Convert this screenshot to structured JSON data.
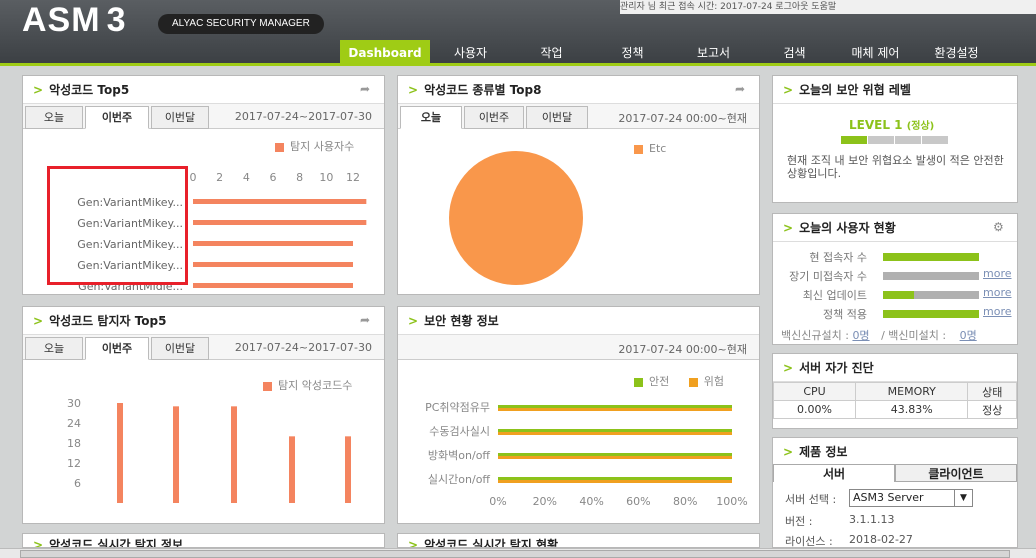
{
  "header": {
    "logo": "ASM",
    "logo_num": "3",
    "tagline": "ALYAC SECURITY MANAGER",
    "top_strip": "관리자 님    최근 접속 시간: 2017-07-24    로그아웃    도움말"
  },
  "nav": {
    "items": [
      "Dashboard",
      "사용자",
      "작업",
      "정책",
      "보고서",
      "검색",
      "매체 제어",
      "환경설정"
    ]
  },
  "malware_top5": {
    "title": "악성코드 Top5",
    "tabs": [
      "오늘",
      "이번주",
      "이번달"
    ],
    "active_tab": "이번주",
    "date_range": "2017-07-24~2017-07-30",
    "legend": "탐지 사용자수",
    "legend_color": "#f4845f",
    "chart_data": {
      "type": "bar",
      "orientation": "horizontal",
      "categories": [
        "Gen:VariantMikey...",
        "Gen:VariantMikey...",
        "Gen:VariantMikey...",
        "Gen:VariantMikey...",
        "Gen:VariantMidie..."
      ],
      "series": [
        {
          "name": "탐지 사용자수",
          "values": [
            13,
            13,
            12,
            12,
            12
          ]
        }
      ],
      "xticks": [
        "0",
        "2",
        "4",
        "6",
        "8",
        "10",
        "12"
      ],
      "xlim": [
        0,
        12
      ]
    }
  },
  "malware_type_top8": {
    "title": "악성코드 종류별 Top8",
    "tabs": [
      "오늘",
      "이번주",
      "이번달"
    ],
    "active_tab": "오늘",
    "date_range": "2017-07-24 00:00~현재",
    "legend": "Etc",
    "legend_color": "#f9974b",
    "chart_data": {
      "type": "pie",
      "categories": [
        "Etc"
      ],
      "values": [
        100
      ]
    }
  },
  "detector_top5": {
    "title": "악성코드 탐지자 Top5",
    "tabs": [
      "오늘",
      "이번주",
      "이번달"
    ],
    "active_tab": "이번주",
    "date_range": "2017-07-24~2017-07-30",
    "legend": "탐지 악성코드수",
    "legend_color": "#f4845f",
    "chart_data": {
      "type": "bar",
      "categories": [
        "",
        "",
        "",
        "",
        ""
      ],
      "series": [
        {
          "name": "탐지 악성코드수",
          "values": [
            30,
            29,
            29,
            20,
            20
          ]
        }
      ],
      "yticks": [
        "6",
        "12",
        "18",
        "24",
        "30"
      ],
      "ylim": [
        0,
        33
      ]
    }
  },
  "security_status": {
    "title": "보안 현황 정보",
    "date_range": "2017-07-24 00:00~현재",
    "legend_safe": "안전",
    "legend_risk": "위험",
    "color_safe": "#8cc21a",
    "color_risk": "#f0a020",
    "chart_data": {
      "type": "bar",
      "orientation": "horizontal",
      "categories": [
        "PC취약점유무",
        "수동검사실시",
        "방화벽on/off",
        "실시간on/off"
      ],
      "series": [
        {
          "name": "안전",
          "values": [
            100,
            100,
            100,
            100
          ]
        },
        {
          "name": "위험",
          "values": [
            0,
            0,
            0,
            0
          ]
        }
      ],
      "xticks": [
        "0%",
        "20%",
        "40%",
        "60%",
        "80%",
        "100%"
      ],
      "xlim": [
        0,
        100
      ]
    }
  },
  "threat_level": {
    "title": "오늘의 보안 위협 레벨",
    "level": "LEVEL 1",
    "level_tag": "(정상)",
    "level_value": 1,
    "level_max": 4,
    "description": "현재 조직 내 보안 위협요소 발생이 적은 안전한 상황입니다."
  },
  "user_status": {
    "title": "오늘의 사용자 현황",
    "rows": [
      {
        "label": "현 접속자 수",
        "fill": 1.0,
        "more": ""
      },
      {
        "label": "장기 미접속자 수",
        "fill": 0.0,
        "more": "more"
      },
      {
        "label": "최신 업데이트",
        "fill": 0.32,
        "more": "more"
      },
      {
        "label": "정책 적용",
        "fill": 1.0,
        "more": "more"
      }
    ],
    "vaccine_new_label": "백신신규설치 :",
    "vaccine_new_val": "0명",
    "vaccine_not_label": "/ 백신미설치 :",
    "vaccine_not_val": "0명"
  },
  "server_diag": {
    "title": "서버 자가 진단",
    "headers": [
      "CPU",
      "MEMORY",
      "상태"
    ],
    "values": [
      "0.00%",
      "43.83%",
      "정상"
    ]
  },
  "product_info": {
    "title": "제품 정보",
    "tab_server": "서버",
    "tab_client": "클라이언트",
    "select_label": "서버 선택 :",
    "select_value": "ASM3 Server",
    "version_label": "버전 :",
    "version_value": "3.1.1.13",
    "license_label": "라이선스 :",
    "license_value": "2018-02-27"
  },
  "bottom_titles": {
    "left": "악성코드 실시간 탐지 정보",
    "mid": "악성코드 실시간 탐지 현황"
  }
}
